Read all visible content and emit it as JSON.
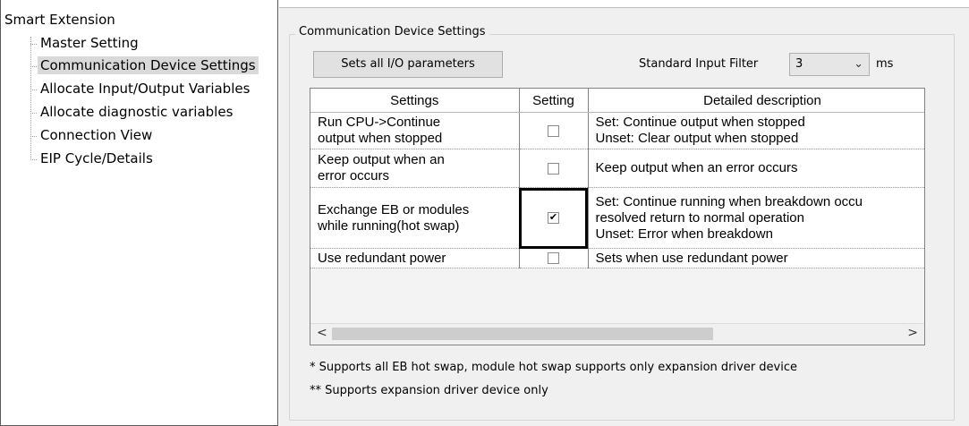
{
  "tree": {
    "root": "Smart Extension",
    "items": [
      {
        "label": "Master Setting"
      },
      {
        "label": "Communication Device Settings",
        "selected": true
      },
      {
        "label": "Allocate Input/Output Variables"
      },
      {
        "label": "Allocate diagnostic variables"
      },
      {
        "label": "Connection View"
      },
      {
        "label": "EIP Cycle/Details"
      }
    ]
  },
  "panel": {
    "group_title": "Communication Device Settings",
    "set_all_button": "Sets all I/O parameters",
    "filter_label": "Standard Input Filter",
    "filter_value": "3",
    "filter_arrow_icon": "chevron-down-icon",
    "filter_unit": "ms"
  },
  "table": {
    "headers": [
      "Settings",
      "Setting",
      "Detailed description"
    ],
    "rows": [
      {
        "setting": [
          "Run CPU->Continue",
          "output when stopped"
        ],
        "checked": false,
        "checkmark": "",
        "description": [
          "Set: Continue output when stopped",
          "Unset: Clear output when stopped"
        ]
      },
      {
        "setting": [
          "Keep output when an",
          "error occurs"
        ],
        "checked": false,
        "checkmark": "",
        "description": [
          "Keep output when an error occurs"
        ]
      },
      {
        "setting": [
          "Exchange EB or modules",
          "while running(hot swap)"
        ],
        "checked": true,
        "checkmark": "✔",
        "description": [
          "Set: Continue running when breakdown occu",
          "resolved return to normal operation",
          "Unset: Error when breakdown"
        ]
      },
      {
        "setting": [
          "Use redundant power"
        ],
        "checked": false,
        "checkmark": "",
        "description": [
          "Sets when use redundant power"
        ]
      }
    ],
    "scroll_left": "<",
    "scroll_right": ">"
  },
  "notes": {
    "note1": "* Supports all EB hot swap, module hot swap supports only expansion driver device",
    "note2": "** Supports expansion driver device only"
  },
  "colors": {
    "panel_bg": "#f0f0f0",
    "selection_bg": "#d9d9d9",
    "grid_border": "#828282"
  }
}
